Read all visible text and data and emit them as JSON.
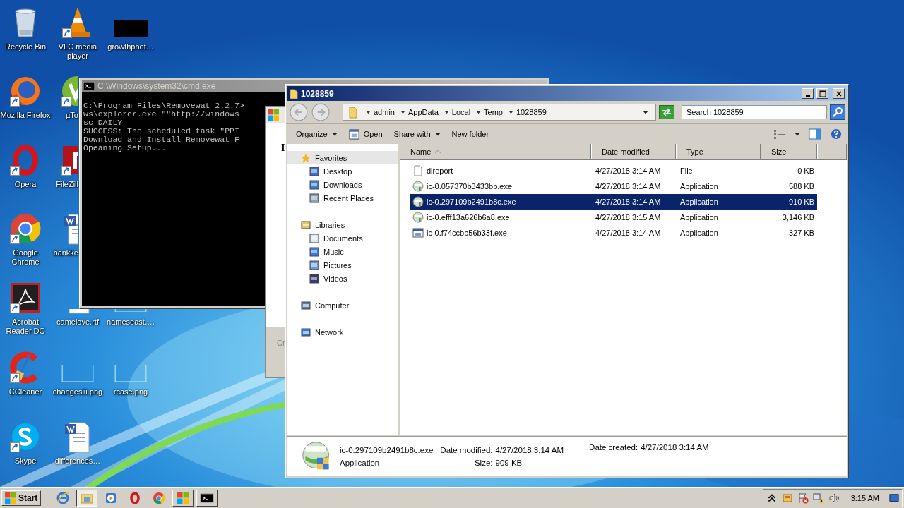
{
  "desktop_icons": [
    {
      "label": "Recycle Bin",
      "kind": "bin",
      "shortcut": false,
      "clipped": false
    },
    {
      "label": "VLC media player",
      "kind": "vlc",
      "shortcut": true,
      "clipped": false
    },
    {
      "label": "growthphot…",
      "kind": "thumb",
      "shortcut": false,
      "clipped": false
    },
    {
      "label": "Mozilla Firefox",
      "kind": "firefox",
      "shortcut": true,
      "clipped": false
    },
    {
      "label": "µTo",
      "kind": "torrent",
      "shortcut": true,
      "clipped": true
    },
    {
      "label": "Opera",
      "kind": "opera",
      "shortcut": true,
      "clipped": false
    },
    {
      "label": "FileZill",
      "kind": "filezilla",
      "shortcut": true,
      "clipped": true
    },
    {
      "label": "Google Chrome",
      "kind": "chrome",
      "shortcut": true,
      "clipped": false
    },
    {
      "label": "bankke",
      "kind": "word",
      "shortcut": false,
      "clipped": true
    },
    {
      "label": "Acrobat Reader DC",
      "kind": "acrobat",
      "shortcut": true,
      "clipped": false
    },
    {
      "label": "camelove.rtf",
      "kind": "word",
      "shortcut": false,
      "clipped": false
    },
    {
      "label": "nameseast….",
      "kind": "blank",
      "shortcut": false,
      "clipped": false
    },
    {
      "label": "CCleaner",
      "kind": "ccleaner",
      "shortcut": true,
      "clipped": false
    },
    {
      "label": "changesiii.png",
      "kind": "blank",
      "shortcut": false,
      "clipped": false
    },
    {
      "label": "rcase.png",
      "kind": "blank",
      "shortcut": false,
      "clipped": false
    },
    {
      "label": "Skype",
      "kind": "skype",
      "shortcut": true,
      "clipped": false
    },
    {
      "label": "differences…",
      "kind": "word",
      "shortcut": false,
      "clipped": false
    }
  ],
  "cmd_window": {
    "title": "C:\\Windows\\system32\\cmd.exe",
    "lines": [
      "C:\\Program Files\\Removewat 2.2.7>",
      "ws\\explorer.exe \"\"http://windows",
      "sc DAILY",
      "SUCCESS: The scheduled task \"PPI",
      "Download and Install Removewat F",
      "Opeaning Setup..."
    ]
  },
  "dialog_fragment": {
    "body_text": "I",
    "footer_text": "— Cr"
  },
  "explorer": {
    "title": "1028859",
    "breadcrumb": [
      "admin",
      "AppData",
      "Local",
      "Temp",
      "1028859"
    ],
    "search": {
      "placeholder": "Search 1028859"
    },
    "toolbar": [
      {
        "label": "Organize",
        "kind": "menu"
      },
      {
        "label": "Open",
        "kind": "icon"
      },
      {
        "label": "Share with",
        "kind": "menu"
      },
      {
        "label": "New folder",
        "kind": "plain"
      }
    ],
    "nav": [
      {
        "label": "Favorites",
        "selected": true,
        "children": [
          {
            "label": "Desktop",
            "selected": false
          },
          {
            "label": "Downloads",
            "selected": false
          },
          {
            "label": "Recent Places",
            "selected": false
          }
        ]
      },
      {
        "label": "Libraries",
        "selected": false,
        "children": [
          {
            "label": "Documents",
            "selected": false
          },
          {
            "label": "Music",
            "selected": false
          },
          {
            "label": "Pictures",
            "selected": false
          },
          {
            "label": "Videos",
            "selected": false
          }
        ]
      },
      {
        "label": "Computer",
        "selected": false
      },
      {
        "label": "Network",
        "selected": false
      }
    ],
    "columns": [
      {
        "label": "Name",
        "sorted": true
      },
      {
        "label": "Date modified",
        "sorted": false
      },
      {
        "label": "Type",
        "sorted": false
      },
      {
        "label": "Size",
        "sorted": false
      }
    ],
    "files": [
      {
        "name": "dlreport",
        "kind": "file",
        "date": "4/27/2018 3:14 AM",
        "type": "File",
        "size": "0 KB",
        "selected": false
      },
      {
        "name": "ic-0.057370b3433bb.exe",
        "kind": "installer",
        "date": "4/27/2018 3:14 AM",
        "type": "Application",
        "size": "588 KB",
        "selected": false
      },
      {
        "name": "ic-0.297109b2491b8c.exe",
        "kind": "installer",
        "date": "4/27/2018 3:14 AM",
        "type": "Application",
        "size": "910 KB",
        "selected": true
      },
      {
        "name": "ic-0.efff13a626b6a8.exe",
        "kind": "installer",
        "date": "4/27/2018 3:15 AM",
        "type": "Application",
        "size": "3,146 KB",
        "selected": false
      },
      {
        "name": "ic-0.f74ccbb56b33f.exe",
        "kind": "window",
        "date": "4/27/2018 3:14 AM",
        "type": "Application",
        "size": "327 KB",
        "selected": false
      }
    ],
    "details": {
      "name": "ic-0.297109b2491b8c.exe",
      "type": "Application",
      "modified_label": "Date modified:",
      "modified": "4/27/2018 3:14 AM",
      "size_label": "Size:",
      "size": "909 KB",
      "created_label": "Date created:",
      "created": "4/27/2018 3:14 AM"
    }
  },
  "taskbar": {
    "start": "Start",
    "apps": [
      {
        "kind": "ie",
        "open": false,
        "active": false
      },
      {
        "kind": "explorer",
        "open": true,
        "active": true
      },
      {
        "kind": "media",
        "open": false,
        "active": false
      },
      {
        "kind": "opera",
        "open": false,
        "active": false
      },
      {
        "kind": "chrome",
        "open": false,
        "active": false
      },
      {
        "kind": "logo",
        "open": true,
        "active": false
      },
      {
        "kind": "cmd",
        "open": true,
        "active": false
      }
    ],
    "clock": "3:15 AM"
  }
}
